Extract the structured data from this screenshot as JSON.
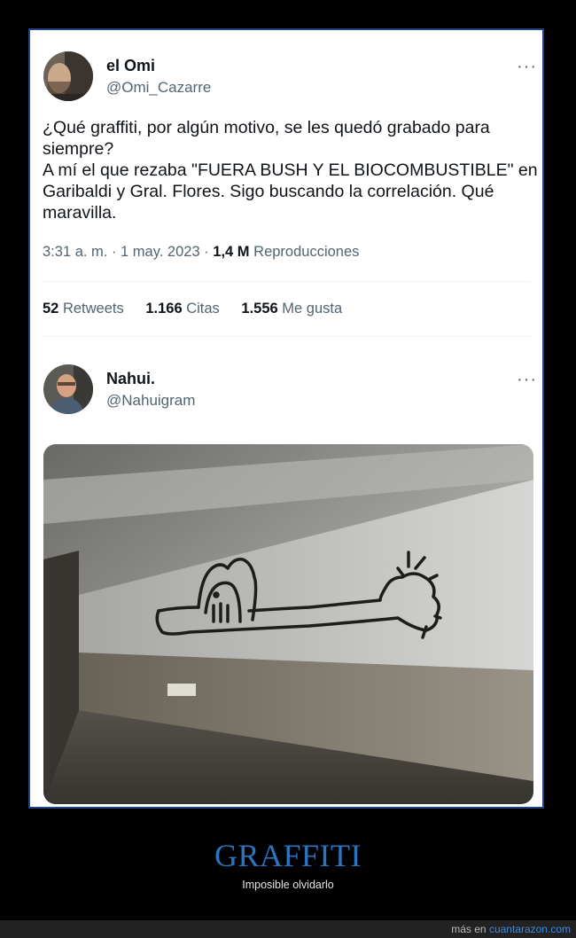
{
  "tweet1": {
    "name": "el Omi",
    "handle": "@Omi_Cazarre",
    "more_icon": "···",
    "lines": [
      "¿Qué graffiti, por algún motivo, se les quedó grabado para",
      "siempre?",
      "A mí el que rezaba \"FUERA BUSH Y EL BIOCOMBUSTIBLE\" en",
      "Garibaldi y Gral. Flores. Sigo buscando la correlación. Qué",
      "maravilla."
    ],
    "time": "3:31 a. m. · 1 may. 2023 · ",
    "views_count": "1,4 M",
    "views_label": " Reproducciones",
    "retweets_count": "52",
    "retweets_label": " Retweets",
    "quotes_count": "1.166",
    "quotes_label": " Citas",
    "likes_count": "1.556",
    "likes_label": " Me gusta"
  },
  "tweet2": {
    "name": "Nahui.",
    "handle": "@Nahuigram",
    "more_icon": "···"
  },
  "caption": {
    "title": "GRAFFITI",
    "subtitle": "Imposible olvidarlo"
  },
  "footer": {
    "prefix": "más en ",
    "site": "cuantarazon.com"
  },
  "colors": {
    "frame_border": "#22438a",
    "title": "#2a74c0",
    "link": "#3a8be0"
  }
}
